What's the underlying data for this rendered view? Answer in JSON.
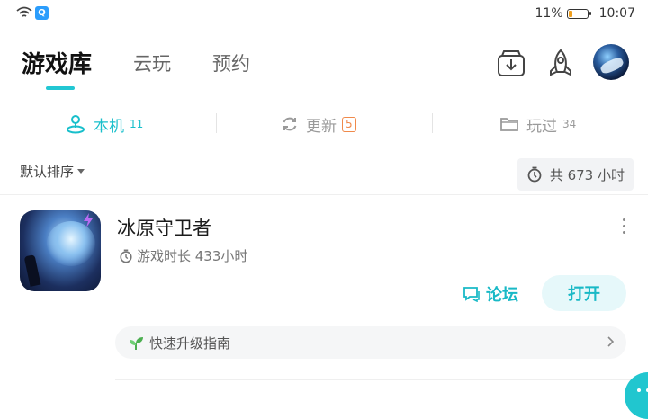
{
  "status_bar": {
    "battery": "11%",
    "time": "10:07",
    "app_badge": "Q"
  },
  "header": {
    "tabs": [
      {
        "label": "游戏库",
        "active": true
      },
      {
        "label": "云玩",
        "active": false
      },
      {
        "label": "预约",
        "active": false
      }
    ],
    "icons": [
      "download-icon",
      "rocket-icon",
      "avatar"
    ]
  },
  "subtabs": [
    {
      "label": "本机",
      "count": "11",
      "icon": "joystick-icon",
      "active": true
    },
    {
      "label": "更新",
      "count": "5",
      "icon": "refresh-icon",
      "active": false
    },
    {
      "label": "玩过",
      "count": "34",
      "icon": "folder-icon",
      "active": false
    }
  ],
  "sort": {
    "label": "默认排序",
    "total": "共 673 小时"
  },
  "game": {
    "title": "冰原守卫者",
    "playtime": "游戏时长 433小时",
    "forum_label": "论坛",
    "open_label": "打开",
    "guide_label": "快速升级指南"
  },
  "colors": {
    "accent": "#19b9c6",
    "update_badge": "#f08a4b"
  }
}
